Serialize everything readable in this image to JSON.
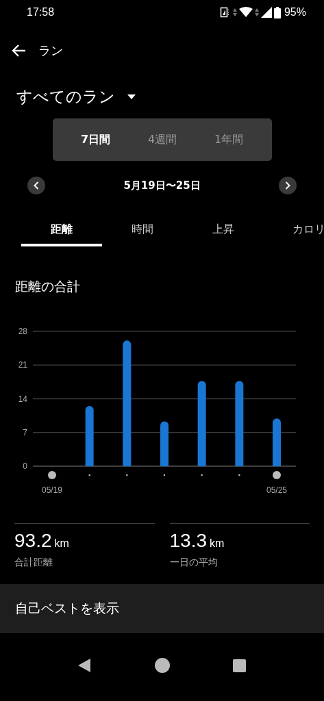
{
  "status_bar": {
    "time": "17:58",
    "battery": "95%"
  },
  "app_bar": {
    "title": "ラン"
  },
  "filter": {
    "label": "すべてのラン"
  },
  "periods": [
    {
      "label": "7日間",
      "selected": true
    },
    {
      "label": "4週間",
      "selected": false
    },
    {
      "label": "1年間",
      "selected": false
    }
  ],
  "date_range": "5月19日〜25日",
  "tabs": [
    {
      "label": "距離",
      "selected": true
    },
    {
      "label": "時間",
      "selected": false
    },
    {
      "label": "上昇",
      "selected": false
    },
    {
      "label": "カロリ",
      "selected": false
    }
  ],
  "section_title": "距離の合計",
  "chart_data": {
    "type": "bar",
    "categories": [
      "05/19",
      null,
      null,
      null,
      null,
      null,
      "05/25"
    ],
    "series": [
      {
        "color": "#1976d2",
        "values": [
          0,
          12.5,
          26.1,
          9.3,
          17.7,
          17.7,
          9.9
        ]
      }
    ],
    "ylim": [
      0,
      28
    ],
    "yticks": [
      0,
      7,
      14,
      21,
      28
    ],
    "grid": true
  },
  "stats": [
    {
      "value": "93.2",
      "unit": "km",
      "label": "合計距離"
    },
    {
      "value": "13.3",
      "unit": "km",
      "label": "一日の平均"
    }
  ],
  "action": "自己ベストを表示"
}
